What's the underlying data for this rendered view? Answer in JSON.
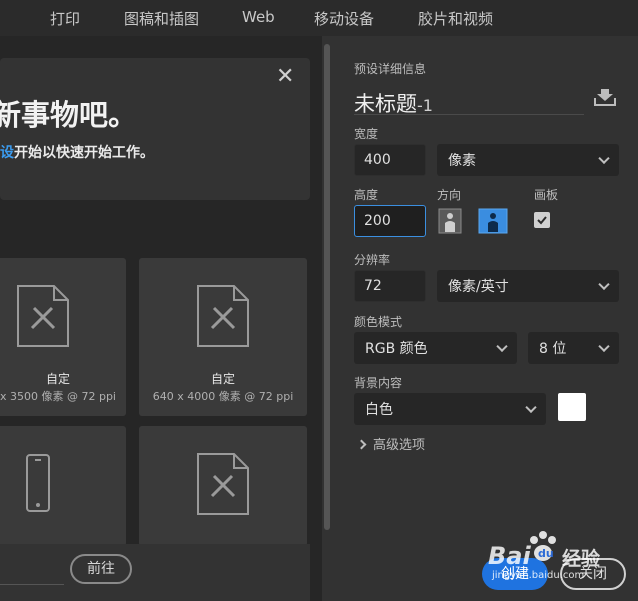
{
  "tabs": [
    "打印",
    "图稿和插图",
    "Web",
    "移动设备",
    "胶片和视频"
  ],
  "banner": {
    "title": "新事物吧。",
    "subtitle_link": "设",
    "subtitle": "开始以快速开始工作。",
    "close": "✕"
  },
  "cards": [
    {
      "title": "自定",
      "size": "x 3500 像素 @ 72 ppi"
    },
    {
      "title": "自定",
      "size": "640 x 4000 像素 @ 72 ppi"
    }
  ],
  "bottom": {
    "goto_label": "前往"
  },
  "panel": {
    "section_title": "预设详细信息",
    "doc_name": "未标题",
    "doc_suffix": "-1",
    "width_label": "宽度",
    "width_value": "400",
    "width_unit": "像素",
    "height_label": "高度",
    "height_value": "200",
    "orientation_label": "方向",
    "artboard_label": "画板",
    "resolution_label": "分辨率",
    "resolution_value": "72",
    "resolution_unit": "像素/英寸",
    "color_mode_label": "颜色模式",
    "color_mode": "RGB 颜色",
    "bit_depth": "8 位",
    "background_label": "背景内容",
    "background": "白色",
    "advanced_label": "高级选项",
    "create_label": "创建",
    "close_label": "关闭"
  },
  "watermark": {
    "brand": "Bai",
    "text": "经验",
    "url": "jingyan.baidu.com"
  },
  "colors": {
    "accent": "#1f73e0",
    "focus": "#3b8fe0",
    "link": "#3b9cf0"
  }
}
